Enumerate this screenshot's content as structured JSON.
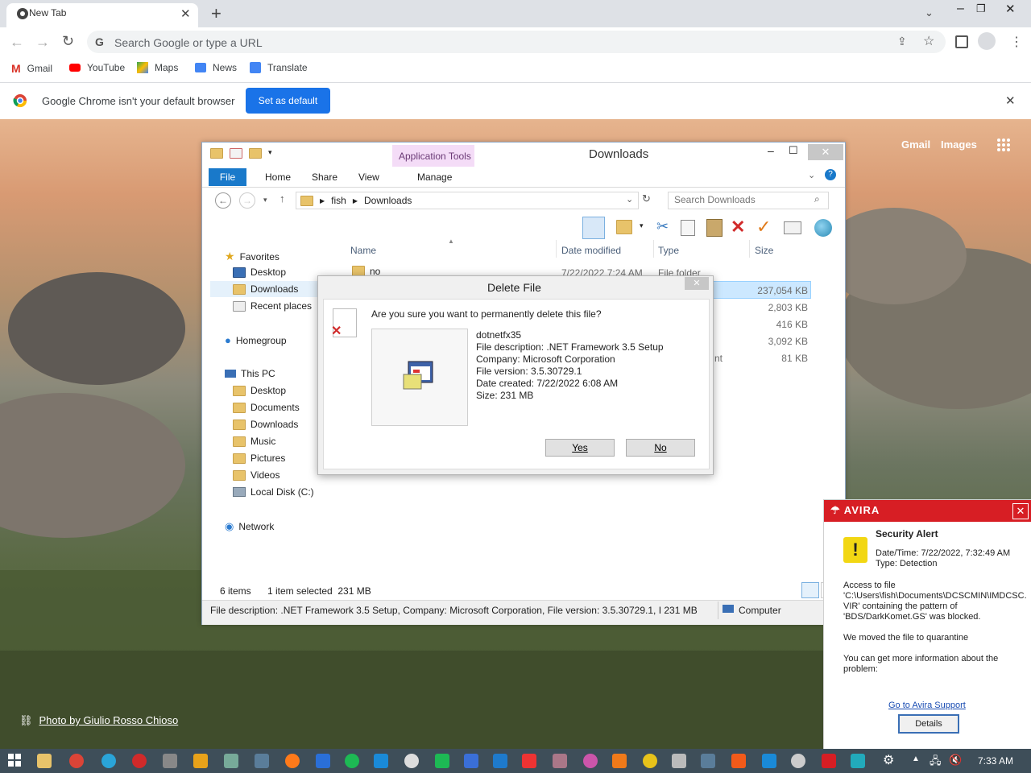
{
  "browser": {
    "tab_title": "New Tab",
    "omnibox_placeholder": "Search Google or type a URL",
    "bookmarks": [
      "Gmail",
      "YouTube",
      "Maps",
      "News",
      "Translate"
    ],
    "infobar_text": "Google Chrome isn't your default browser",
    "infobar_button": "Set as default"
  },
  "newtab": {
    "links": [
      "Gmail",
      "Images"
    ],
    "photo_credit": "Photo by Giulio Rosso Chioso"
  },
  "explorer": {
    "title": "Downloads",
    "context_tab": "Application Tools",
    "ribbon_tabs": [
      "File",
      "Home",
      "Share",
      "View",
      "Manage"
    ],
    "breadcrumb": [
      "fish",
      "Downloads"
    ],
    "search_placeholder": "Search Downloads",
    "nav_favorites": [
      "Favorites",
      "Desktop",
      "Downloads",
      "Recent places"
    ],
    "nav_homegroup": "Homegroup",
    "nav_thispc": [
      "This PC",
      "Desktop",
      "Documents",
      "Downloads",
      "Music",
      "Pictures",
      "Videos",
      "Local Disk (C:)"
    ],
    "nav_network": "Network",
    "columns": [
      "Name",
      "Date modified",
      "Type",
      "Size"
    ],
    "row1": {
      "name": "no",
      "date": "7/22/2022 7:24 AM",
      "type": "File folder"
    },
    "sizes": [
      "237,054 KB",
      "2,803 KB",
      "416 KB",
      "3,092 KB",
      "81 KB"
    ],
    "partial_type": "nt",
    "status_items": "6 items",
    "status_selected": "1 item selected  231 MB",
    "details_bar": "File description: .NET Framework 3.5 Setup, Company: Microsoft Corporation, File version: 3.5.30729.1, I 231 MB",
    "details_computer": "Computer"
  },
  "dialog": {
    "title": "Delete File",
    "question": "Are you sure you want to permanently delete this file?",
    "file_name": "dotnetfx35",
    "file_description": "File description: .NET Framework 3.5 Setup",
    "company": "Company: Microsoft Corporation",
    "version": "File version: 3.5.30729.1",
    "created": "Date created: 7/22/2022 6:08 AM",
    "size": "Size: 231 MB",
    "yes": "Yes",
    "no": "No"
  },
  "avira": {
    "brand": "AVIRA",
    "heading": "Security Alert",
    "datetime": "Date/Time: 7/22/2022, 7:32:49 AM",
    "type": "Type: Detection",
    "msg1_l1": "Access to file",
    "msg1_l2": "'C:\\Users\\fish\\Documents\\DCSCMIN\\IMDCSC.",
    "msg1_l3": "VIR' containing the pattern of",
    "msg1_l4": "'BDS/DarkKomet.GS' was blocked.",
    "msg2": "We moved the file to quarantine",
    "msg3_l1": "You can get more information about the",
    "msg3_l2": "problem:",
    "support_link": "Go to Avira Support",
    "details_button": "Details"
  },
  "taskbar": {
    "clock": "7:33 AM"
  },
  "colors": {
    "chrome_blue": "#1a73e8",
    "avira_red": "#d71e24",
    "explorer_file_tab": "#1979ca"
  }
}
